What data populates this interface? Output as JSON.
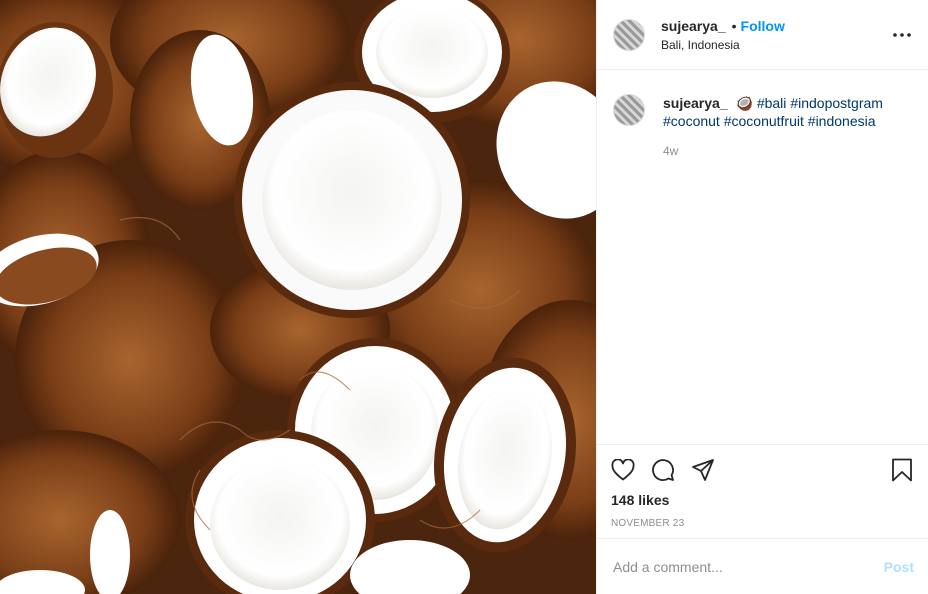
{
  "post": {
    "username": "sujearya_",
    "follow_label": "Follow",
    "separator": "•",
    "location": "Bali, Indonesia",
    "more_icon": "more-horizontal-icon",
    "caption": {
      "username": "sujearya_",
      "emoji": "🥥",
      "hashtags": [
        "#bali",
        "#indopostgram",
        "#coconut",
        "#coconutfruit",
        "#indonesia"
      ]
    },
    "caption_time": "4w",
    "likes": "148 likes",
    "date": "NOVEMBER 23",
    "comment_placeholder": "Add a comment...",
    "post_label": "Post",
    "icons": {
      "like": "heart-icon",
      "comment": "comment-icon",
      "share": "send-icon",
      "save": "bookmark-icon"
    },
    "colors": {
      "link_blue": "#0095f6",
      "hashtag": "#00376b",
      "muted": "#8e8e8e",
      "post_disabled": "#b2dffc"
    }
  }
}
